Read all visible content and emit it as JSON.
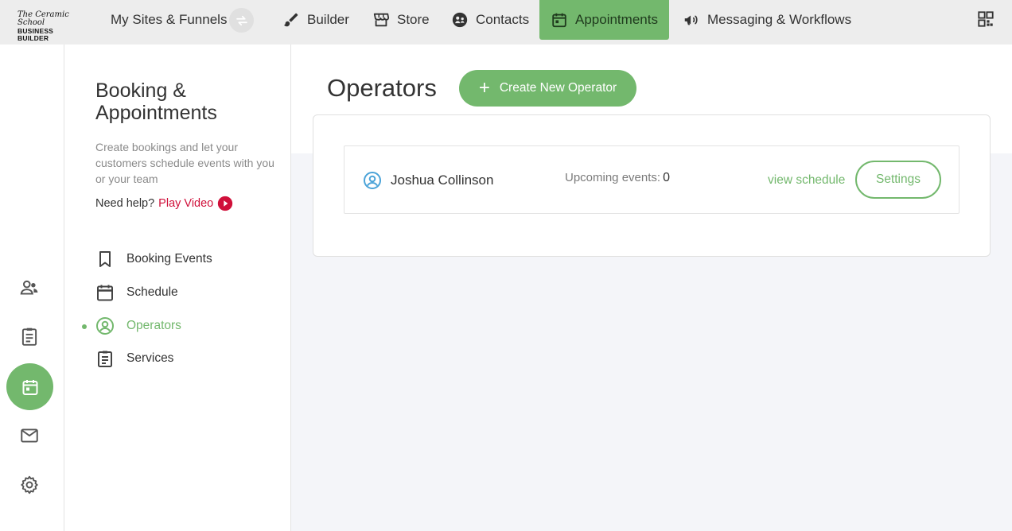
{
  "brand": {
    "line1": "The Ceramic School",
    "line2": "BUSINESS BUILDER"
  },
  "topnav": {
    "sites": "My Sites & Funnels",
    "builder": "Builder",
    "store": "Store",
    "contacts": "Contacts",
    "appointments": "Appointments",
    "messaging": "Messaging & Workflows"
  },
  "sidebar": {
    "title": "Booking & Appointments",
    "description": "Create bookings and let your customers schedule events with you or your team",
    "help_label": "Need help?",
    "play_video": "Play Video",
    "items": [
      {
        "label": "Booking Events"
      },
      {
        "label": "Schedule"
      },
      {
        "label": "Operators"
      },
      {
        "label": "Services"
      }
    ]
  },
  "main": {
    "title": "Operators",
    "create_button": "Create New Operator",
    "operators": [
      {
        "name": "Joshua Collinson",
        "upcoming_label": "Upcoming events:",
        "upcoming_count": "0",
        "view_link": "view schedule",
        "settings_button": "Settings"
      }
    ]
  },
  "colors": {
    "accent": "#73b86d",
    "link_red": "#d0103a",
    "topbar": "#ededed",
    "main_bg": "#f4f5f9"
  }
}
